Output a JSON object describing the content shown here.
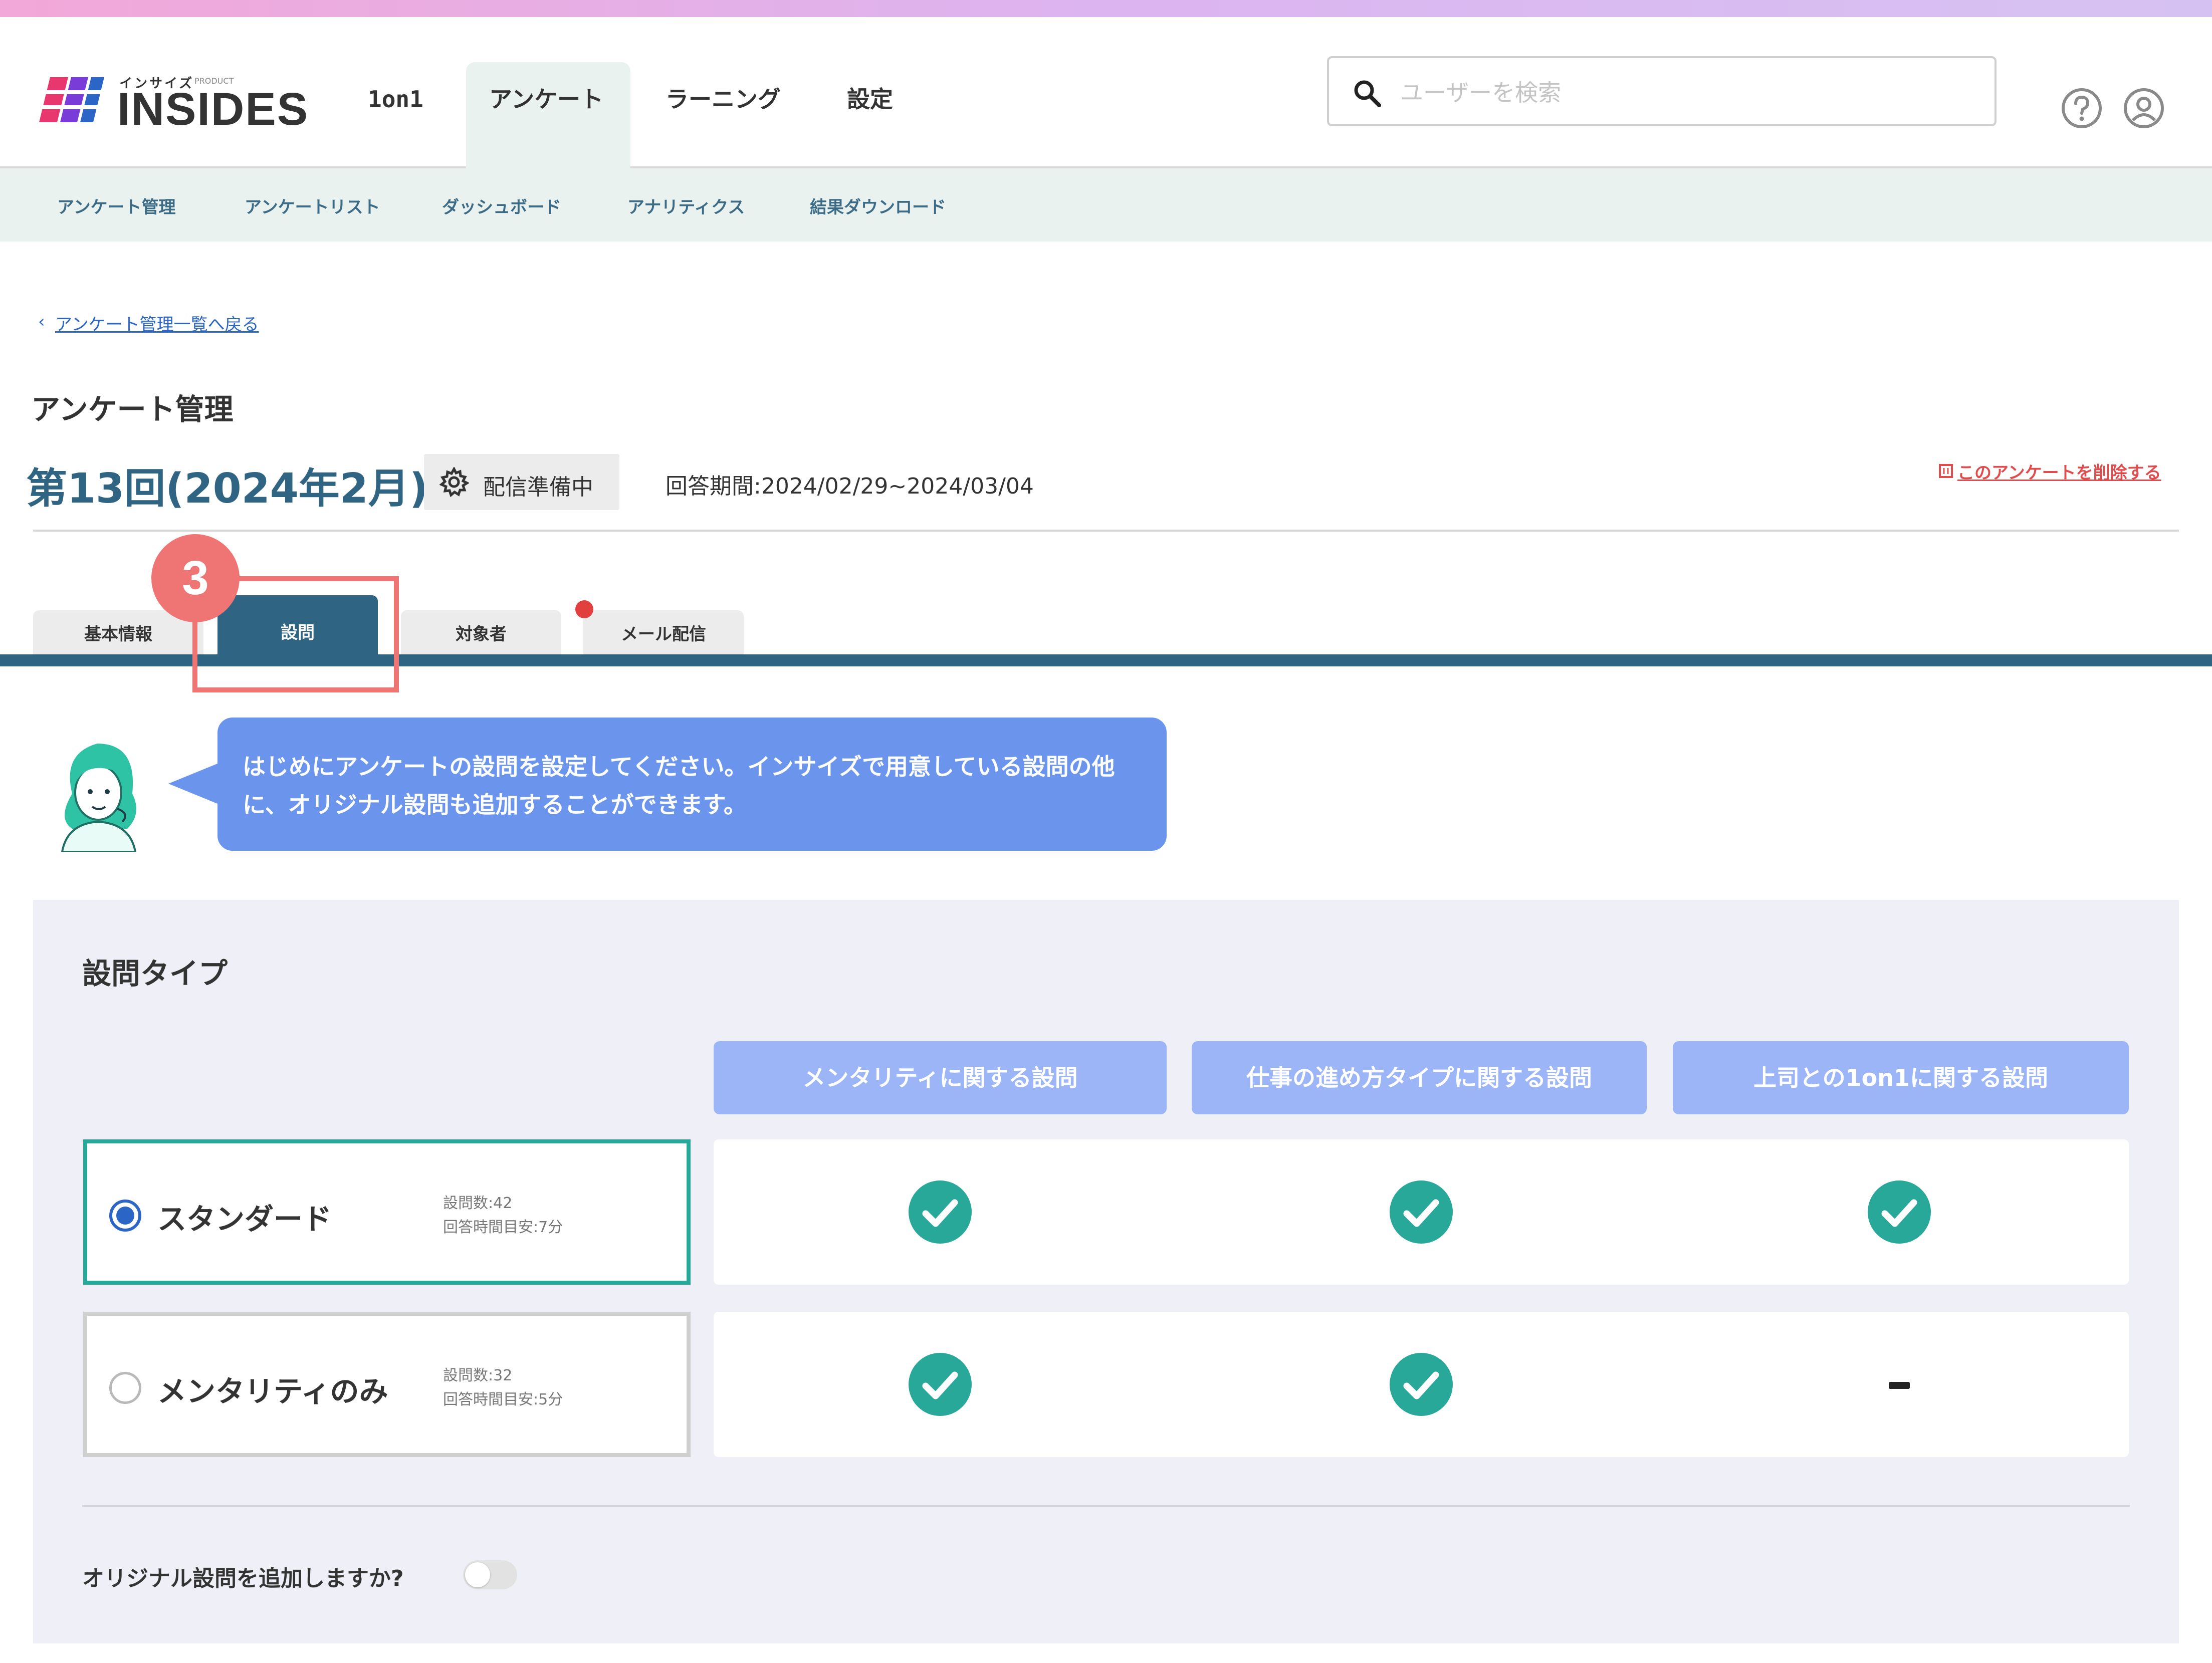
{
  "brand": {
    "logo_text": "INSIDES",
    "logo_small": "インサイズ",
    "logo_product": "PRODUCT"
  },
  "header": {
    "nav": [
      "1on1",
      "アンケート",
      "ラーニング",
      "設定"
    ],
    "active_nav": "アンケート",
    "search_placeholder": "ユーザーを検索",
    "icons": [
      "help-icon",
      "user-icon"
    ]
  },
  "subnav": {
    "items": [
      "アンケート管理",
      "アンケートリスト",
      "ダッシュボード",
      "アナリティクス",
      "結果ダウンロード"
    ]
  },
  "breadcrumb": {
    "back_label": "アンケート管理一覧へ戻る"
  },
  "page": {
    "heading": "アンケート管理",
    "survey_title": "第13回(2024年2月)",
    "status": "配信準備中",
    "period": "回答期間:2024/02/29~2024/03/04",
    "delete_label": "このアンケートを削除する"
  },
  "tabs": {
    "items": [
      "基本情報",
      "設問",
      "対象者",
      "メール配信"
    ],
    "active": "設問",
    "step_badge": "3"
  },
  "guide": {
    "message": "はじめにアンケートの設問を設定してください。インサイズで用意している設問の他に、オリジナル設問も追加することができます。"
  },
  "question_type": {
    "title": "設問タイプ",
    "columns": [
      "メンタリティに関する設問",
      "仕事の進め方タイプに関する設問",
      "上司との1on1に関する設問"
    ],
    "options": [
      {
        "label": "スタンダード",
        "count": "設問数:42",
        "time": "回答時間目安:7分",
        "selected": true,
        "includes": [
          "check",
          "check",
          "check"
        ]
      },
      {
        "label": "メンタリティのみ",
        "count": "設問数:32",
        "time": "回答時間目安:5分",
        "selected": false,
        "includes": [
          "check",
          "check",
          "-"
        ]
      }
    ],
    "original_label": "オリジナル設問を追加しますか?",
    "original_enabled": false
  },
  "colors": {
    "accent": "#2f6482",
    "teal": "#28a898",
    "column_header": "#9bb5f7",
    "bubble": "#6b95ec",
    "highlight": "#ef7474"
  }
}
